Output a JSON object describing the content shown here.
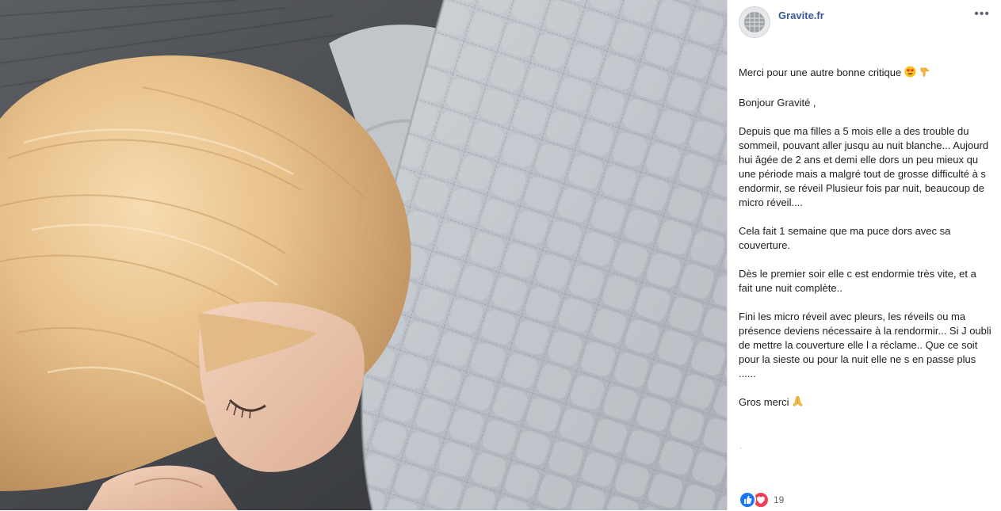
{
  "page": {
    "name": "Gravite.fr",
    "more_label": "•••"
  },
  "post": {
    "intro": "Merci pour une autre bonne critique",
    "greeting": "Bonjour Gravité ,",
    "p1": "Depuis que ma filles a 5 mois elle a des trouble du sommeil, pouvant aller jusqu au nuit blanche... Aujourd hui âgée de 2 ans et demi elle dors un peu mieux qu une période mais a malgré tout de grosse difficulté à s endormir, se réveil Plusieur fois par nuit, beaucoup de micro réveil....",
    "p2": "Cela fait 1 semaine que ma puce dors avec sa couverture.",
    "p3": "Dès le premier soir elle c est endormie très vite, et a fait une nuit complète..",
    "p4": "Fini les micro réveil avec pleurs, les réveils ou ma présence deviens nécessaire à la rendormir... Si J oubli de mettre la couverture elle l a réclame.. Que ce soit pour la sieste ou pour la nuit elle ne s en passe plus ......",
    "thanks": "Gros merci",
    "trailing_dot": "."
  },
  "reactions": {
    "count": "19",
    "icons": [
      "like-icon",
      "love-icon"
    ],
    "like_color": "#1877f2",
    "love_color": "#f33e58"
  },
  "colors": {
    "page_link": "#385898",
    "text": "#1c1e21",
    "meta": "#606770"
  }
}
